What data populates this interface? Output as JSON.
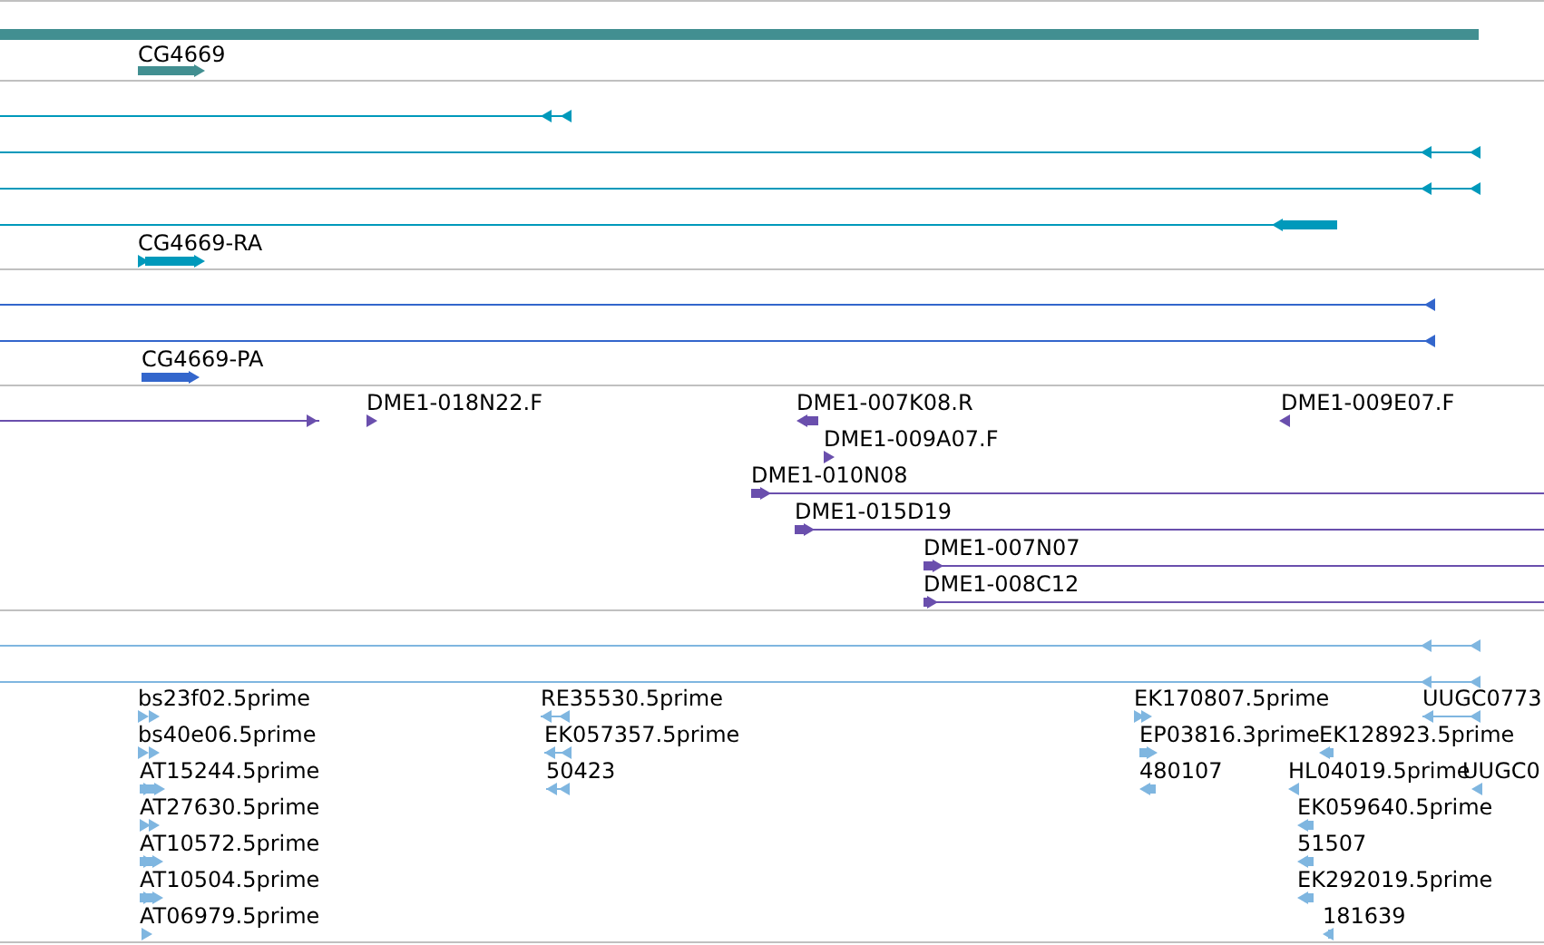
{
  "tracks": [
    {
      "color": "#428f91",
      "features": [
        {
          "label": "CG4669",
          "reverse": false
        }
      ]
    },
    {
      "color": "#0099bb",
      "features": [
        {
          "reverse": true
        },
        {
          "reverse": true
        },
        {
          "reverse": true
        },
        {
          "reverse": true
        },
        {
          "label": "CG4669-RA",
          "reverse": false
        }
      ]
    },
    {
      "color": "#3366cc",
      "features": [
        {
          "reverse": true
        },
        {
          "reverse": true
        },
        {
          "label": "CG4669-PA",
          "reverse": false
        }
      ]
    },
    {
      "color": "#6a4fad",
      "features": [
        {
          "reverse": false
        },
        {
          "label": "DME1-018N22.F",
          "reverse": false
        },
        {
          "label": "DME1-007K08.R",
          "reverse": true
        },
        {
          "label": "DME1-009E07.F",
          "reverse": true
        },
        {
          "label": "DME1-009A07.F",
          "reverse": false
        },
        {
          "label": "DME1-010N08",
          "reverse": false
        },
        {
          "label": "DME1-015D19",
          "reverse": false
        },
        {
          "label": "DME1-007N07",
          "reverse": false
        },
        {
          "label": "DME1-008C12",
          "reverse": false
        }
      ]
    },
    {
      "color": "#7fb6e0",
      "features": [
        {
          "reverse": true
        },
        {
          "reverse": true
        },
        {
          "label": "bs23f02.5prime",
          "reverse": false
        },
        {
          "label": "bs40e06.5prime",
          "reverse": false
        },
        {
          "label": "AT15244.5prime",
          "reverse": false
        },
        {
          "label": "AT27630.5prime",
          "reverse": false
        },
        {
          "label": "AT10572.5prime",
          "reverse": false
        },
        {
          "label": "AT10504.5prime",
          "reverse": false
        },
        {
          "label": "AT06979.5prime",
          "reverse": false
        },
        {
          "label": "RE35530.5prime",
          "reverse": true
        },
        {
          "label": "EK057357.5prime",
          "reverse": true
        },
        {
          "label": "50423",
          "reverse": true
        },
        {
          "label": "EK170807.5prime",
          "reverse": false
        },
        {
          "label": "UUGC0773",
          "reverse": true
        },
        {
          "label": "EP03816.3prime",
          "reverse": false
        },
        {
          "label": "EK128923.5prime",
          "reverse": true
        },
        {
          "label": "480107",
          "reverse": true
        },
        {
          "label": "HL04019.5prime",
          "reverse": true
        },
        {
          "label": "UUGC0",
          "reverse": true
        },
        {
          "label": "EK059640.5prime",
          "reverse": true
        },
        {
          "label": "51507",
          "reverse": true
        },
        {
          "label": "EK292019.5prime",
          "reverse": true
        },
        {
          "label": "181639",
          "reverse": true
        }
      ]
    }
  ]
}
